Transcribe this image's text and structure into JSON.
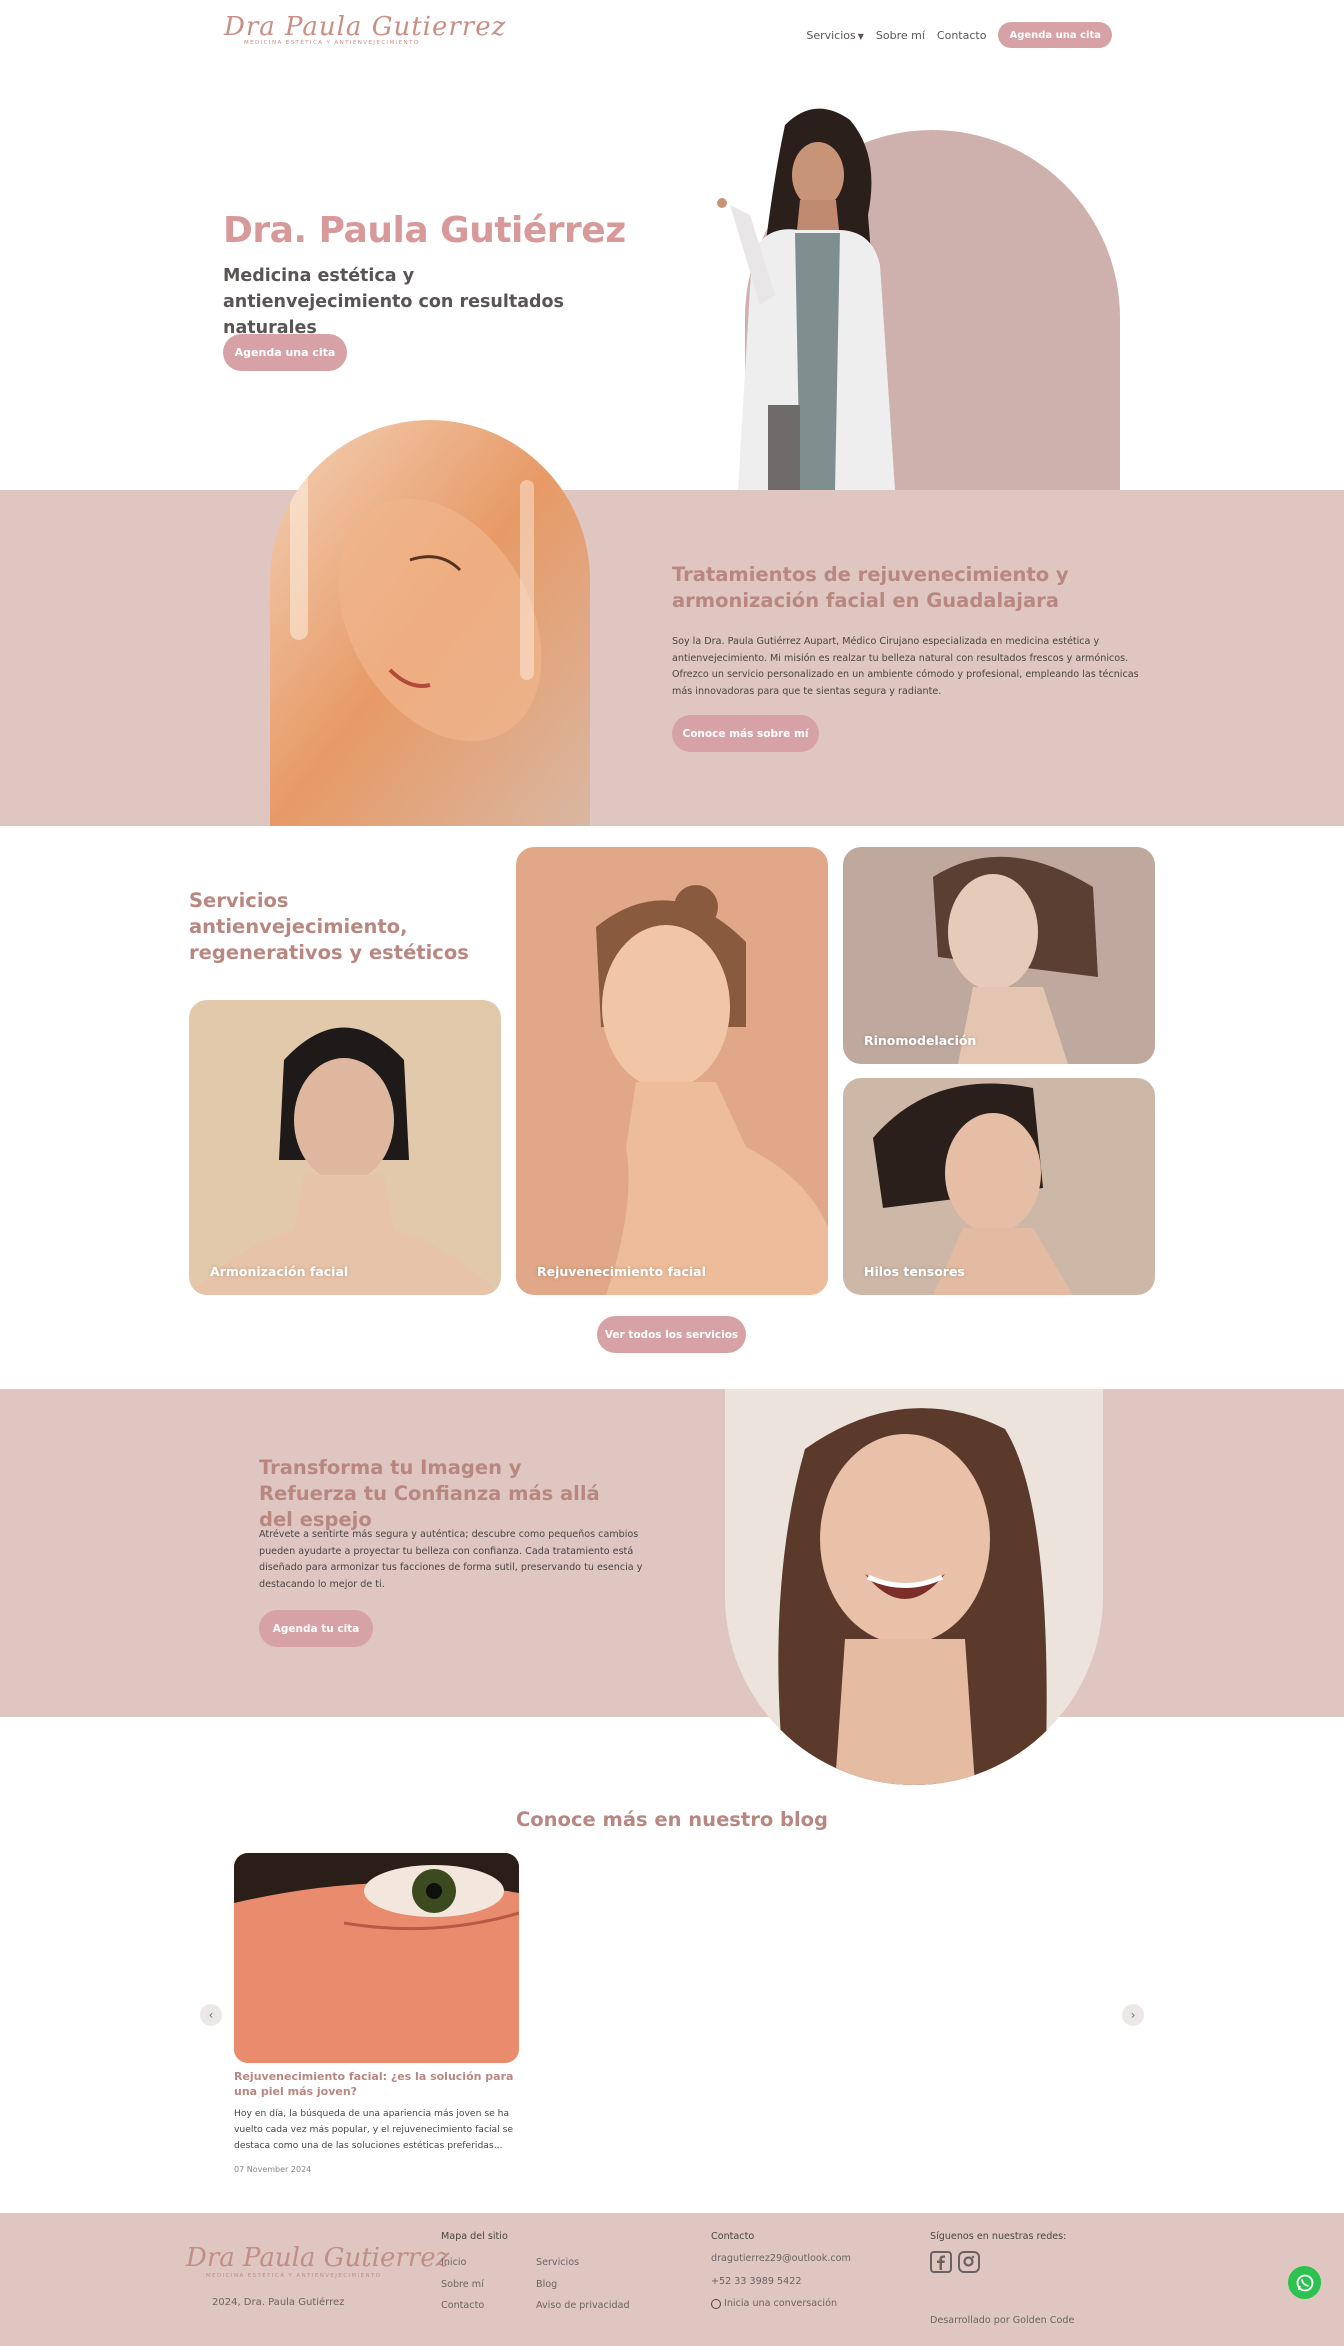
{
  "brand": {
    "logo_script": "Dra Paula Gutierrez",
    "logo_tagline": "Medicina estética y antienvejecimiento"
  },
  "nav": {
    "items": [
      "Servicios",
      "Sobre mí",
      "Contacto"
    ],
    "cta": "Agenda una cita"
  },
  "hero": {
    "title": "Dra. Paula Gutiérrez",
    "subtitle": "Medicina estética y antienvejecimiento con resultados naturales",
    "button": "Agenda una cita"
  },
  "about": {
    "title": "Tratamientos de rejuvenecimiento y armonización facial en Guadalajara",
    "text": "Soy la Dra. Paula Gutiérrez Aupart, Médico Cirujano especializada en medicina estética y antienvejecimiento. Mi misión es realzar tu belleza natural con resultados frescos y armónicos. Ofrezco un servicio personalizado en un ambiente cómodo y profesional, empleando las técnicas más innovadoras para que te sientas segura y radiante.",
    "button": "Conoce más sobre mí"
  },
  "services": {
    "title": "Servicios antienvejecimiento, regenerativos y estéticos",
    "cards": [
      "Armonización facial",
      "Rejuvenecimiento facial",
      "Rinomodelación",
      "Hilos tensores"
    ],
    "button": "Ver todos los servicios"
  },
  "transform": {
    "title": "Transforma tu Imagen y Refuerza tu Confianza más allá del espejo",
    "text": "Atrévete a sentirte más segura y auténtica; descubre como pequeños cambios pueden ayudarte a proyectar tu belleza con confianza. Cada tratamiento está diseñado para armonizar tus facciones de forma sutil, preservando tu esencia y destacando lo mejor de ti.",
    "button": "Agenda tu cita"
  },
  "blog": {
    "title": "Conoce más en nuestro blog",
    "post": {
      "title": "Rejuvenecimiento facial: ¿es la solución para una piel más joven?",
      "excerpt": "Hoy en día, la búsqueda de una apariencia más joven se ha vuelto cada vez más popular, y el rejuvenecimiento facial se destaca como una de las soluciones estéticas preferidas...",
      "date": "07 November 2024"
    },
    "prev_icon": "chevron-left-icon",
    "next_icon": "chevron-right-icon"
  },
  "footer": {
    "copyright": "2024, Dra. Paula Gutiérrez",
    "sitemap_title": "Mapa del sitio",
    "sitemap_col1": [
      "Inicio",
      "Sobre mí",
      "Contacto"
    ],
    "sitemap_col2": [
      "Servicios",
      "Blog",
      "Aviso de privacidad"
    ],
    "contact_title": "Contacto",
    "email": "dragutierrez29@outlook.com",
    "phone": "+52 33 3989 5422",
    "chat": "Inicia una conversación",
    "social_title": "Síguenos en nuestras redes:",
    "credit": "Desarrollado por Golden Code"
  },
  "colors": {
    "accent": "#d7a2a5",
    "heading": "#b98781",
    "band": "#dfc6c0",
    "whatsapp": "#2bc24f"
  }
}
